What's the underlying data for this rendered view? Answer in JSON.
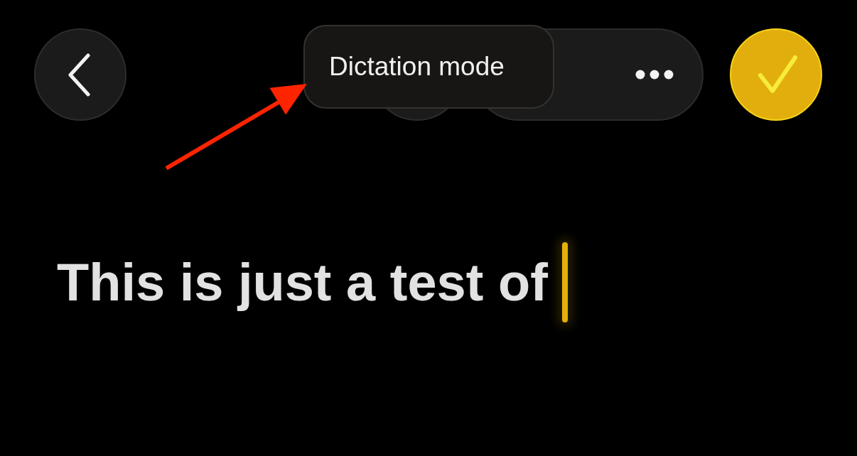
{
  "tooltip": {
    "text": "Dictation mode"
  },
  "editor": {
    "value": "This is just a test of",
    "focused": true
  }
}
